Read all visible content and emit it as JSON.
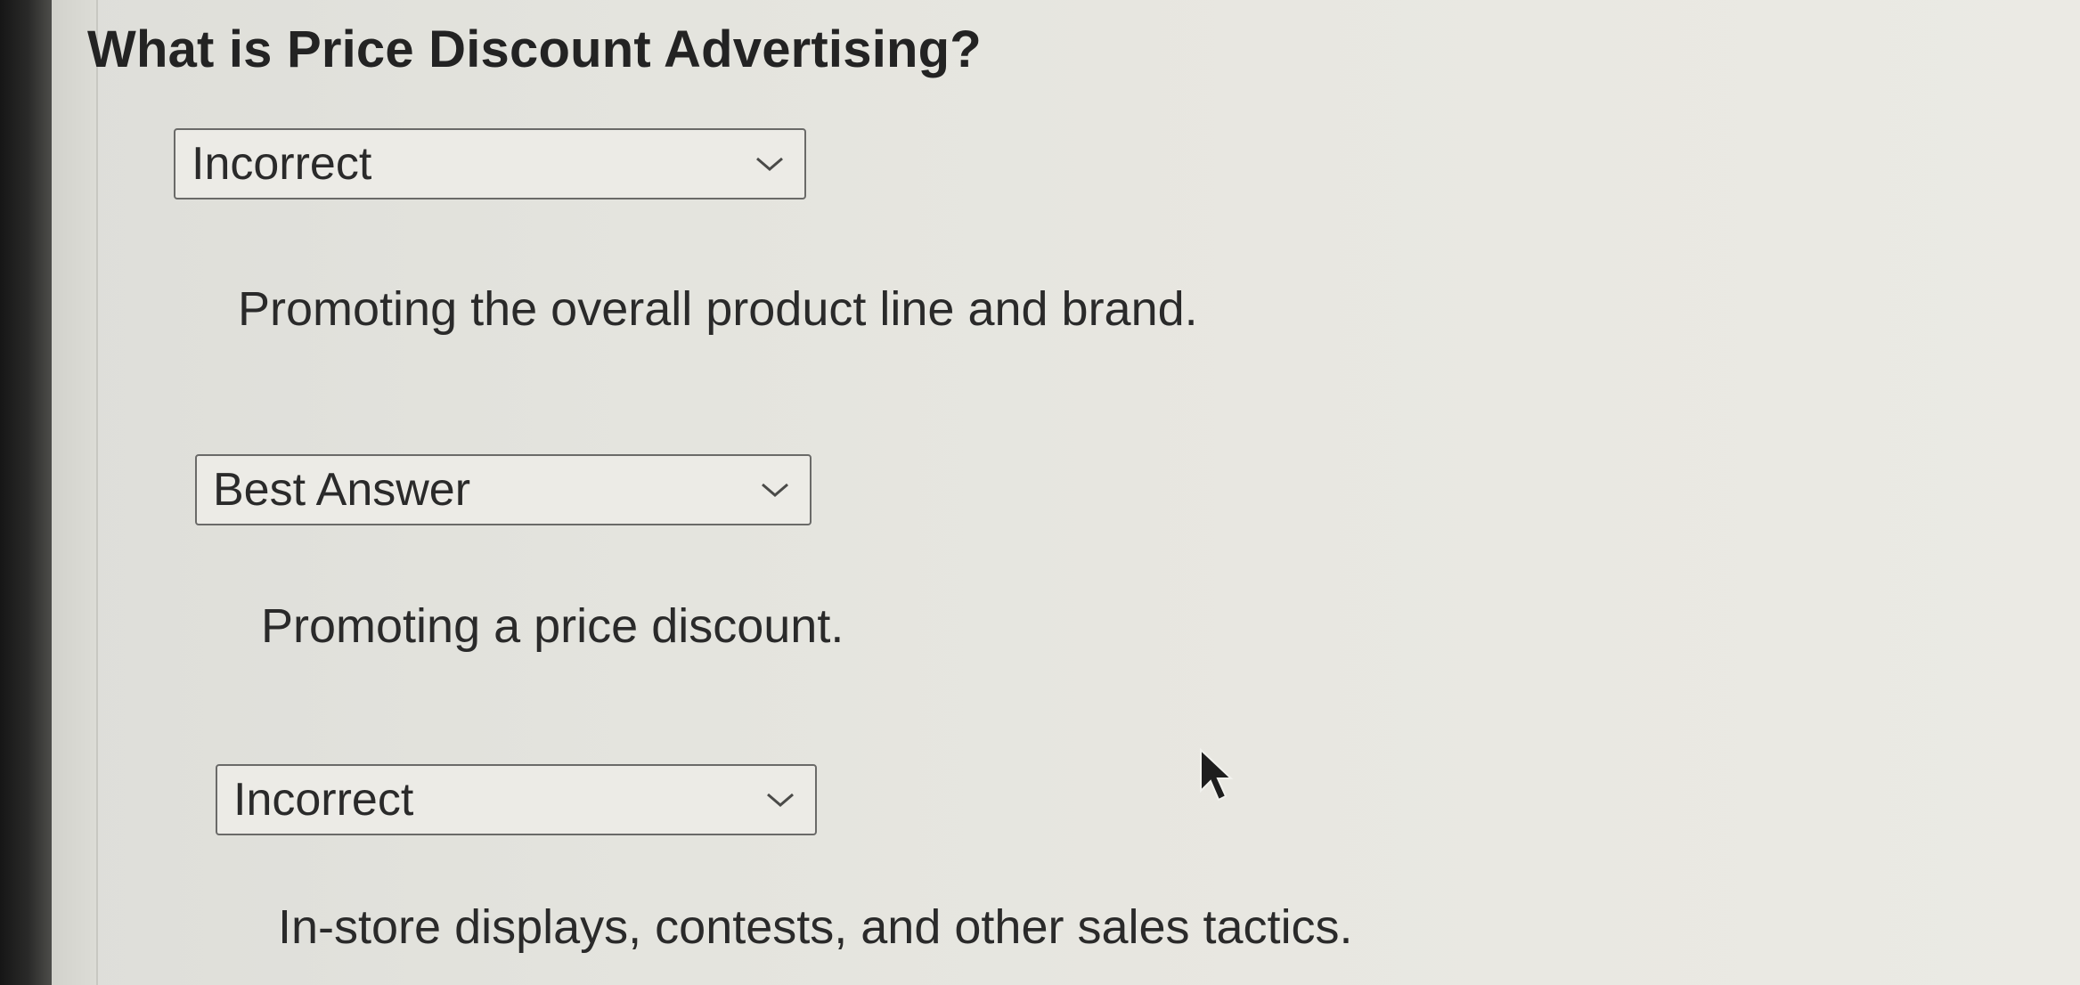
{
  "question": {
    "title": "What is Price Discount Advertising?"
  },
  "answers": [
    {
      "selected": "Incorrect",
      "text": "Promoting the overall product line and brand."
    },
    {
      "selected": "Best Answer",
      "text": "Promoting a price discount."
    },
    {
      "selected": "Incorrect",
      "text": "In-store displays, contests, and other sales tactics."
    }
  ],
  "icons": {
    "dropdown": "chevron-down-icon",
    "cursor": "mouse-pointer-icon"
  },
  "colors": {
    "background": "#e4e4de",
    "text": "#2a2a2a",
    "border": "#6a6a68",
    "bezel": "#161616"
  }
}
